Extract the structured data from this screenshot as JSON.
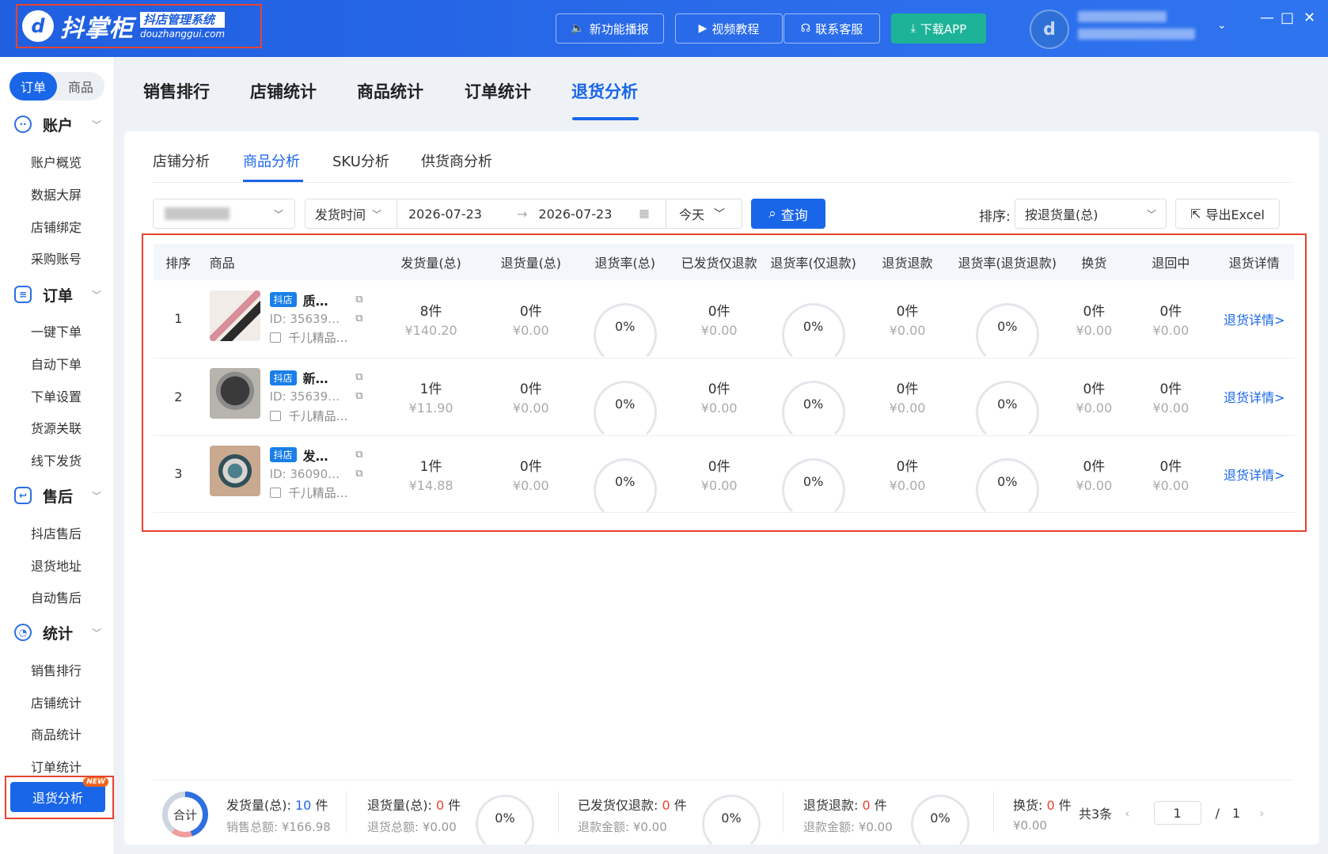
{
  "app": {
    "logo_mark": "d",
    "logo_name": "抖掌柜",
    "logo_sub": "抖店管理系统",
    "logo_url": "douzhanggui.com"
  },
  "topbar": {
    "buttons": [
      "新功能播报",
      "视频教程",
      "联系客服",
      "下载APP"
    ],
    "window_controls": [
      "—",
      "□",
      "✕"
    ]
  },
  "sidebar": {
    "segments": [
      "订单",
      "商品"
    ],
    "groups": [
      {
        "icon": "account-icon",
        "title": "账户",
        "items": [
          "账户概览",
          "数据大屏",
          "店铺绑定",
          "采购账号"
        ]
      },
      {
        "icon": "order-icon",
        "title": "订单",
        "items": [
          "一键下单",
          "自动下单",
          "下单设置",
          "货源关联",
          "线下发货"
        ]
      },
      {
        "icon": "after-sale-icon",
        "title": "售后",
        "items": [
          "抖店售后",
          "退货地址",
          "自动售后"
        ]
      },
      {
        "icon": "stats-icon",
        "title": "统计",
        "items": [
          "销售排行",
          "店铺统计",
          "商品统计",
          "订单统计",
          "退货分析"
        ]
      }
    ],
    "active_badge": "NEW"
  },
  "main_tabs": [
    "销售排行",
    "店铺统计",
    "商品统计",
    "订单统计",
    "退货分析"
  ],
  "sub_tabs": [
    "店铺分析",
    "商品分析",
    "SKU分析",
    "供货商分析"
  ],
  "filters": {
    "date_type": "发货时间",
    "start_date": "2026-07-23",
    "end_date": "2026-07-23",
    "arrow": "→",
    "quick_range": "今天",
    "query": "查询",
    "sort_label": "排序:",
    "sort_value": "按退货量(总)",
    "export": "导出Excel"
  },
  "table": {
    "headers": [
      "排序",
      "商品",
      "发货量(总)",
      "退货量(总)",
      "退货率(总)",
      "已发货仅退款",
      "退货率(仅退款)",
      "退货退款",
      "退货率(退货退款)",
      "换货",
      "退回中",
      "退货详情"
    ],
    "rows": [
      {
        "rank": "1",
        "tag": "抖店",
        "name": "质…",
        "id": "ID: 35639…",
        "shop": "千儿精品…",
        "ship_qty": "8件",
        "ship_amt": "¥140.20",
        "ret_qty": "0件",
        "ret_amt": "¥0.00",
        "ret_rate": "0%",
        "refund_qty": "0件",
        "refund_amt": "¥0.00",
        "refund_rate": "0%",
        "rr_qty": "0件",
        "rr_amt": "¥0.00",
        "rr_rate": "0%",
        "ex_qty": "0件",
        "ex_amt": "¥0.00",
        "back_qty": "0件",
        "back_amt": "¥0.00",
        "detail": "退货详情>"
      },
      {
        "rank": "2",
        "tag": "抖店",
        "name": "新…",
        "id": "ID: 35639…",
        "shop": "千儿精品…",
        "ship_qty": "1件",
        "ship_amt": "¥11.90",
        "ret_qty": "0件",
        "ret_amt": "¥0.00",
        "ret_rate": "0%",
        "refund_qty": "0件",
        "refund_amt": "¥0.00",
        "refund_rate": "0%",
        "rr_qty": "0件",
        "rr_amt": "¥0.00",
        "rr_rate": "0%",
        "ex_qty": "0件",
        "ex_amt": "¥0.00",
        "back_qty": "0件",
        "back_amt": "¥0.00",
        "detail": "退货详情>"
      },
      {
        "rank": "3",
        "tag": "抖店",
        "name": "发…",
        "id": "ID: 36090…",
        "shop": "千儿精品…",
        "ship_qty": "1件",
        "ship_amt": "¥14.88",
        "ret_qty": "0件",
        "ret_amt": "¥0.00",
        "ret_rate": "0%",
        "refund_qty": "0件",
        "refund_amt": "¥0.00",
        "refund_rate": "0%",
        "rr_qty": "0件",
        "rr_amt": "¥0.00",
        "rr_rate": "0%",
        "ex_qty": "0件",
        "ex_amt": "¥0.00",
        "back_qty": "0件",
        "back_amt": "¥0.00",
        "detail": "退货详情>"
      }
    ]
  },
  "footer": {
    "total": "合计",
    "ship_label": "发货量(总):",
    "ship_num": "10",
    "unit": "件",
    "ship_sum": "销售总额: ¥166.98",
    "ret_label": "退货量(总):",
    "ret_num": "0",
    "ret_sum": "退货总额: ¥0.00",
    "ret_rate": "0%",
    "refund_label": "已发货仅退款:",
    "refund_num": "0",
    "refund_sum": "退款金额: ¥0.00",
    "refund_rate": "0%",
    "rr_label": "退货退款:",
    "rr_num": "0",
    "rr_sum": "退款金额: ¥0.00",
    "rr_rate": "0%",
    "ex_label": "换货:",
    "ex_num": "0",
    "ex_sum": "¥0.00",
    "total_count": "共3条",
    "page": "1",
    "page_sep": "/",
    "page_total": "1"
  }
}
